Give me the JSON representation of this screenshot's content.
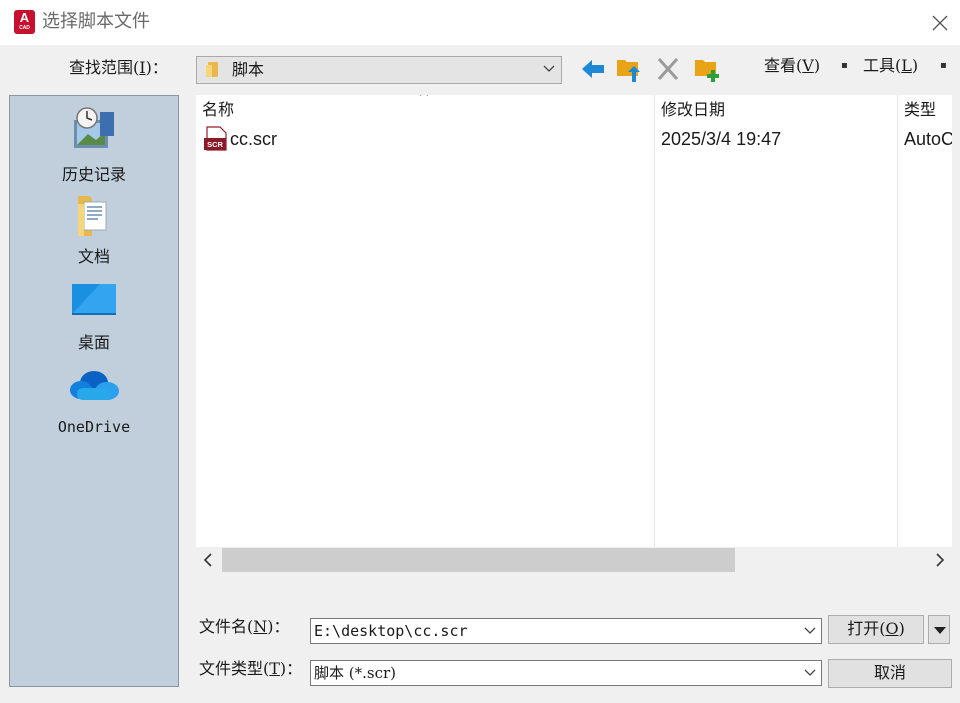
{
  "window": {
    "title": "选择脚本文件",
    "app_icon_letter": "A",
    "app_icon_sub": "CAD",
    "brand_color": "#c8102e"
  },
  "lookin": {
    "label_prefix": "查找范围(",
    "label_key": "I",
    "label_suffix": ")：",
    "value": "脚本"
  },
  "toolbar": {
    "view": {
      "prefix": "查看(",
      "key": "V",
      "suffix": ")"
    },
    "tools": {
      "prefix": "工具(",
      "key": "L",
      "suffix": ")"
    },
    "dropdown_glyph": "▪"
  },
  "places": [
    {
      "label": "历史记录",
      "icon": "history-icon"
    },
    {
      "label": "文档",
      "icon": "documents-icon"
    },
    {
      "label": "桌面",
      "icon": "desktop-icon"
    },
    {
      "label": "OneDrive",
      "icon": "onedrive-icon"
    }
  ],
  "filelist": {
    "columns": [
      "名称",
      "修改日期",
      "类型"
    ],
    "sort_caret": "^",
    "rows": [
      {
        "name": "cc.scr",
        "date": "2025/3/4 19:47",
        "type": "AutoCAD",
        "icon": "scr-file-icon",
        "icon_text": "SCR"
      }
    ]
  },
  "filename": {
    "label_prefix": "文件名(",
    "label_key": "N",
    "label_suffix": ")：",
    "value": "E:\\desktop\\cc.scr"
  },
  "filetype": {
    "label_prefix": "文件类型(",
    "label_key": "T",
    "label_suffix": ")：",
    "value": "脚本 (*.scr)"
  },
  "buttons": {
    "open_prefix": "打开(",
    "open_key": "O",
    "open_suffix": ")",
    "cancel": "取消"
  }
}
